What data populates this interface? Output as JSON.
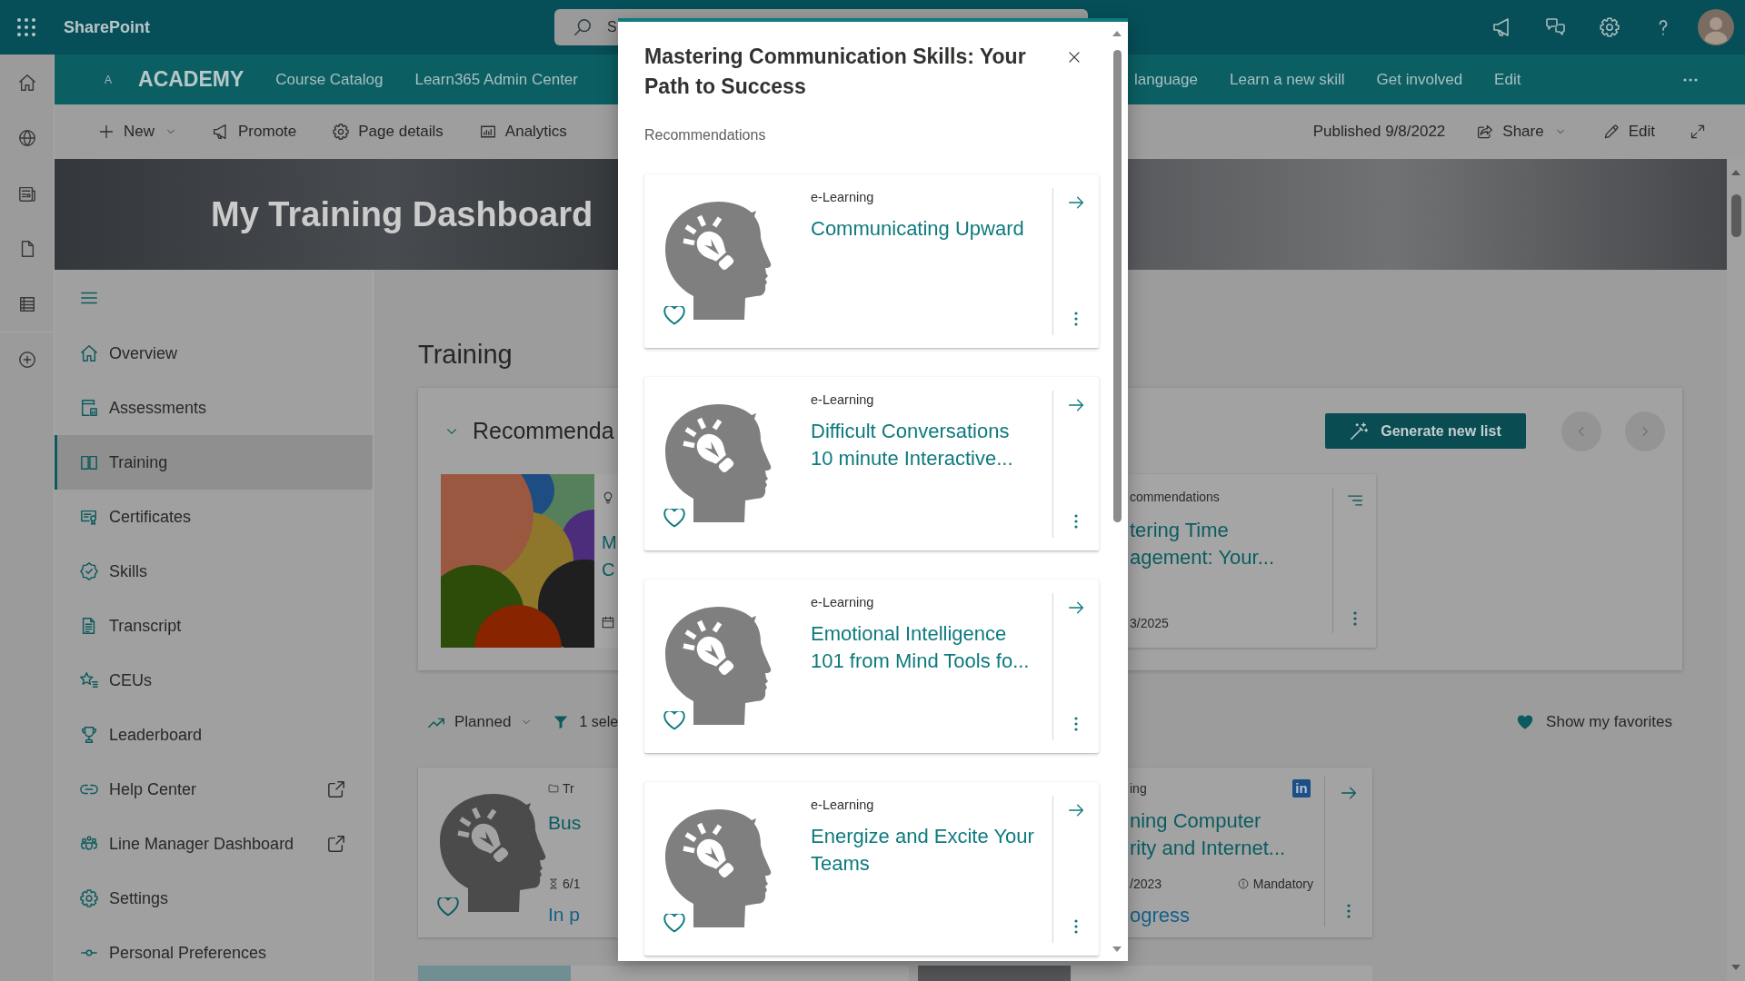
{
  "suite_bar": {
    "app_name": "SharePoint",
    "search": {
      "placeholder": "S"
    }
  },
  "site_nav": {
    "logo": "A",
    "title": "ACADEMY",
    "links": [
      {
        "label": "Course Catalog"
      },
      {
        "label": "Learn365 Admin Center"
      },
      {
        "label": "language"
      },
      {
        "label": "Learn a new skill"
      },
      {
        "label": "Get involved"
      },
      {
        "label": "Edit"
      }
    ]
  },
  "command_bar": {
    "actions": [
      {
        "label": "New",
        "has_menu": true
      },
      {
        "label": "Promote",
        "has_menu": false
      },
      {
        "label": "Page details",
        "has_menu": false
      },
      {
        "label": "Analytics",
        "has_menu": false
      }
    ],
    "published": "Published 9/8/2022",
    "share": {
      "label": "Share",
      "has_menu": true
    },
    "edit": {
      "label": "Edit"
    }
  },
  "hero": {
    "title": "My Training Dashboard"
  },
  "sidebar": {
    "items": [
      {
        "label": "Overview",
        "selected": false,
        "external": false
      },
      {
        "label": "Assessments",
        "selected": false,
        "external": false
      },
      {
        "label": "Training",
        "selected": true,
        "external": false
      },
      {
        "label": "Certificates",
        "selected": false,
        "external": false
      },
      {
        "label": "Skills",
        "selected": false,
        "external": false
      },
      {
        "label": "Transcript",
        "selected": false,
        "external": false
      },
      {
        "label": "CEUs",
        "selected": false,
        "external": false
      },
      {
        "label": "Leaderboard",
        "selected": false,
        "external": false
      },
      {
        "label": "Help Center",
        "selected": false,
        "external": true
      },
      {
        "label": "Line Manager Dashboard",
        "selected": false,
        "external": true
      },
      {
        "label": "Settings",
        "selected": false,
        "external": false
      },
      {
        "label": "Personal Preferences",
        "selected": false,
        "external": false
      }
    ]
  },
  "main": {
    "heading": "Training",
    "recommendations": {
      "title": "Recommenda",
      "expanded": true,
      "generate_button": "Generate new list",
      "cards": [
        {
          "kind": "thumbnail",
          "title_lines": [
            "M",
            "C"
          ]
        },
        {
          "kind": "details",
          "category": "commendations",
          "title_lines": [
            "tering Time",
            "agement: Your..."
          ],
          "date": "3/2025"
        }
      ]
    },
    "filters": {
      "sort": "Planned",
      "filter": "1 sele",
      "favorites": "Show my favorites"
    },
    "courses": [
      {
        "kind": "thumbnail",
        "folder": "Tr",
        "title_lines": [
          "Bus"
        ],
        "due": "6/1",
        "status": "In p",
        "favorite": false
      },
      {
        "kind": "details",
        "category": "ing",
        "provider": "in",
        "title_lines": [
          "ning Computer",
          "rity and Internet..."
        ],
        "due": "/2023",
        "badge": "Mandatory",
        "status": "ogress"
      }
    ]
  },
  "dialog": {
    "title": "Mastering Communication Skills: Your Path to Success",
    "subtitle": "Recommendations",
    "cards": [
      {
        "category": "e-Learning",
        "title_lines": [
          "Communicating Upward"
        ],
        "favorite": false
      },
      {
        "category": "e-Learning",
        "title_lines": [
          "Difficult Conversations",
          "10 minute Interactive..."
        ],
        "favorite": false
      },
      {
        "category": "e-Learning",
        "title_lines": [
          "Emotional Intelligence",
          "101 from Mind Tools fo..."
        ],
        "favorite": false
      },
      {
        "category": "e-Learning",
        "title_lines": [
          "Energize and Excite Your",
          "Teams"
        ],
        "favorite": false
      }
    ]
  }
}
